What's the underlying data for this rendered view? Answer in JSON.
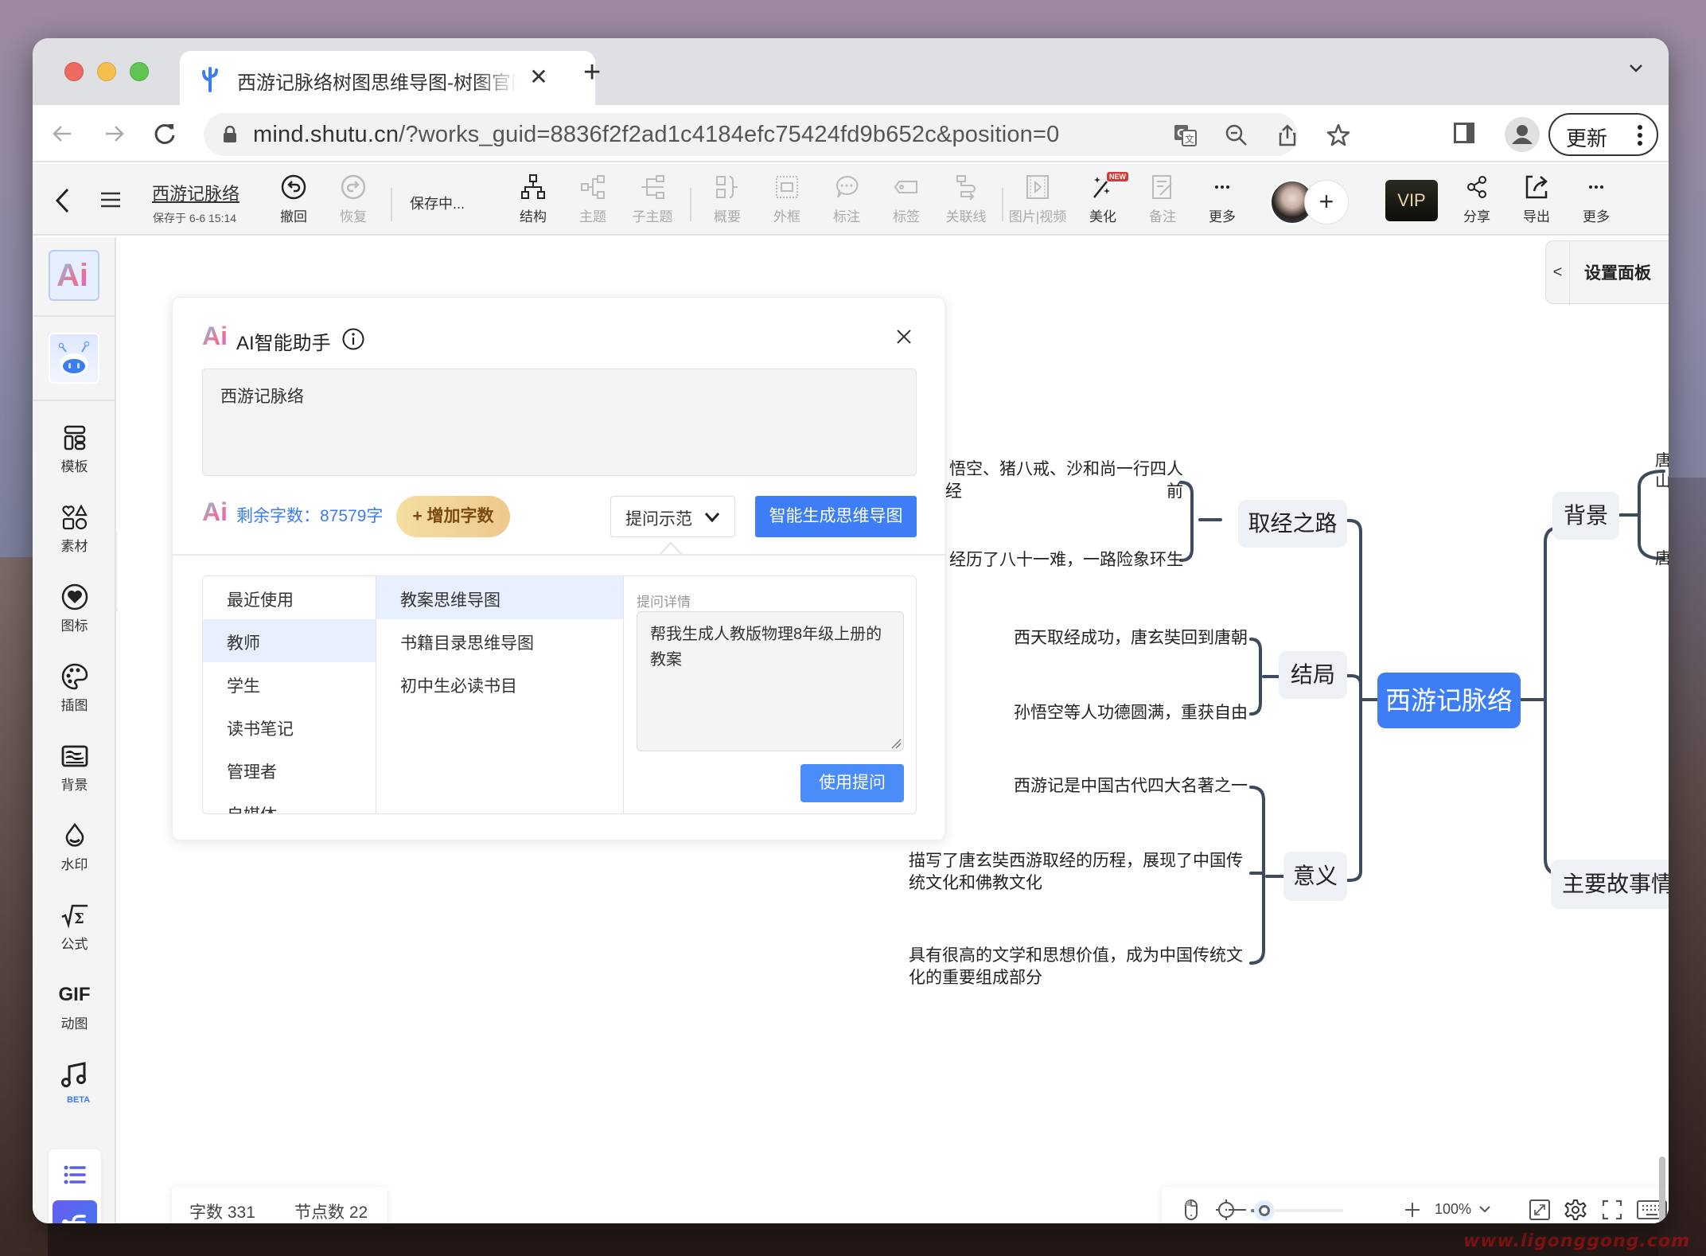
{
  "browser": {
    "tab_title": "西游记脉络树图思维导图-树图官网",
    "url_host": "mind.shutu.cn",
    "url_rest": "/?works_guid=8836f2f2ad1c4184efc75424fd9b652c&position=0",
    "update_label": "更新",
    "icons": [
      "back-arrow-icon",
      "forward-arrow-icon",
      "reload-icon",
      "lock-icon",
      "translate-icon",
      "zoom-out-icon",
      "share-icon",
      "bookmark-star-icon",
      "side-panel-icon",
      "profile-icon",
      "kebab-menu-icon"
    ]
  },
  "toolbar": {
    "doc_title": "西游记脉络",
    "saved_at": "保存于 6-6 15:14",
    "undo": "撤回",
    "redo": "恢复",
    "saving": "保存中...",
    "structure": "结构",
    "topic": "主题",
    "subtopic": "子主题",
    "summary": "概要",
    "frame": "外框",
    "callout": "标注",
    "tag": "标签",
    "relation": "关联线",
    "media": "图片|视频",
    "beautify": "美化",
    "new_badge": "NEW",
    "note": "备注",
    "more1": "更多",
    "vip": "VIP",
    "share": "分享",
    "export": "导出",
    "more2": "更多"
  },
  "sidebar": {
    "ai_label": "Ai",
    "items": [
      {
        "label": "模板",
        "icon": "template-icon"
      },
      {
        "label": "素材",
        "icon": "material-shapes-icon"
      },
      {
        "label": "图标",
        "icon": "heart-icon"
      },
      {
        "label": "插图",
        "icon": "palette-icon"
      },
      {
        "label": "背景",
        "icon": "background-image-icon"
      },
      {
        "label": "水印",
        "icon": "water-drop-icon"
      },
      {
        "label": "公式",
        "icon": "formula-icon"
      },
      {
        "label": "动图",
        "icon": "gif-icon",
        "glyph": "GIF"
      },
      {
        "label": "BETA",
        "icon": "music-note-icon"
      }
    ]
  },
  "settings_panel": {
    "label": "设置面板",
    "chevron": "<"
  },
  "ai_panel": {
    "logo": "Ai",
    "title": "AI智能助手",
    "input_value": "西游记脉络",
    "remaining_words": "剩余字数：87579字",
    "add_words": "+ 增加字数",
    "prompt_demo": "提问示范",
    "generate": "智能生成思维导图",
    "categories": [
      {
        "label": "最近使用",
        "active": false
      },
      {
        "label": "教师",
        "active": true
      },
      {
        "label": "学生",
        "active": false
      },
      {
        "label": "读书笔记",
        "active": false
      },
      {
        "label": "管理者",
        "active": false
      },
      {
        "label": "自媒体",
        "active": false
      }
    ],
    "templates": [
      {
        "label": "教案思维导图",
        "active": true
      },
      {
        "label": "书籍目录思维导图",
        "active": false
      },
      {
        "label": "初中生必读书目",
        "active": false
      }
    ],
    "detail_label": "提问详情",
    "detail_text": "帮我生成人教版物理8年级上册的教案",
    "use_prompt": "使用提问"
  },
  "mindmap": {
    "root": "西游记脉络",
    "branches": [
      {
        "label": "取经之路",
        "children": [
          "孙悟空、猪八戒、沙和尚一行四人前往西天取经",
          "经历了八十一难，一路险象环生"
        ]
      },
      {
        "label": "结局",
        "children": [
          "西天取经成功，唐玄奘回到唐朝",
          "孙悟空等人功德圆满，重获自由"
        ]
      },
      {
        "label": "意义",
        "children": [
          "西游记是中国古代四大名著之一",
          "描写了唐玄奘西游取经的历程，展现了中国传统文化和佛教文化",
          "具有很高的文学和思想价值，成为中国传统文化的重要组成部分"
        ]
      },
      {
        "label": "背景",
        "children": [
          "唐朝年间…山下",
          "唐玄奘…"
        ]
      },
      {
        "label": "主要故事情节",
        "children": []
      }
    ],
    "visible_text": {
      "leaf_qj1": "悟空、猪八戒、沙和尚一行四人前",
      "leaf_qj1_tail": "经",
      "leaf_qj2": "经历了八十一难，一路险象环生",
      "leaf_jj1": "西天取经成功，唐玄奘回到唐朝",
      "leaf_jj2": "孙悟空等人功德圆满，重获自由",
      "leaf_yy1": "西游记是中国古代四大名著之一",
      "leaf_yy2": "描写了唐玄奘西游取经的历程，展现了中国传统文化和佛教文化",
      "leaf_yy3": "具有很高的文学和思想价值，成为中国传统文化的重要组成部分",
      "leaf_bj1": "唐朝年\n山下",
      "leaf_bj2": "唐玄奘"
    }
  },
  "stats": {
    "word_count": "字数 331",
    "node_count": "节点数 22"
  },
  "zoom": {
    "level_label": "100%",
    "slider_fraction": 0.15
  },
  "colors": {
    "accent": "#3d7df5",
    "node_bg": "#eef1f5",
    "line": "#3e4a5e",
    "vip_bg": "#1a1a14"
  },
  "watermark": "www.ligonggong.com"
}
